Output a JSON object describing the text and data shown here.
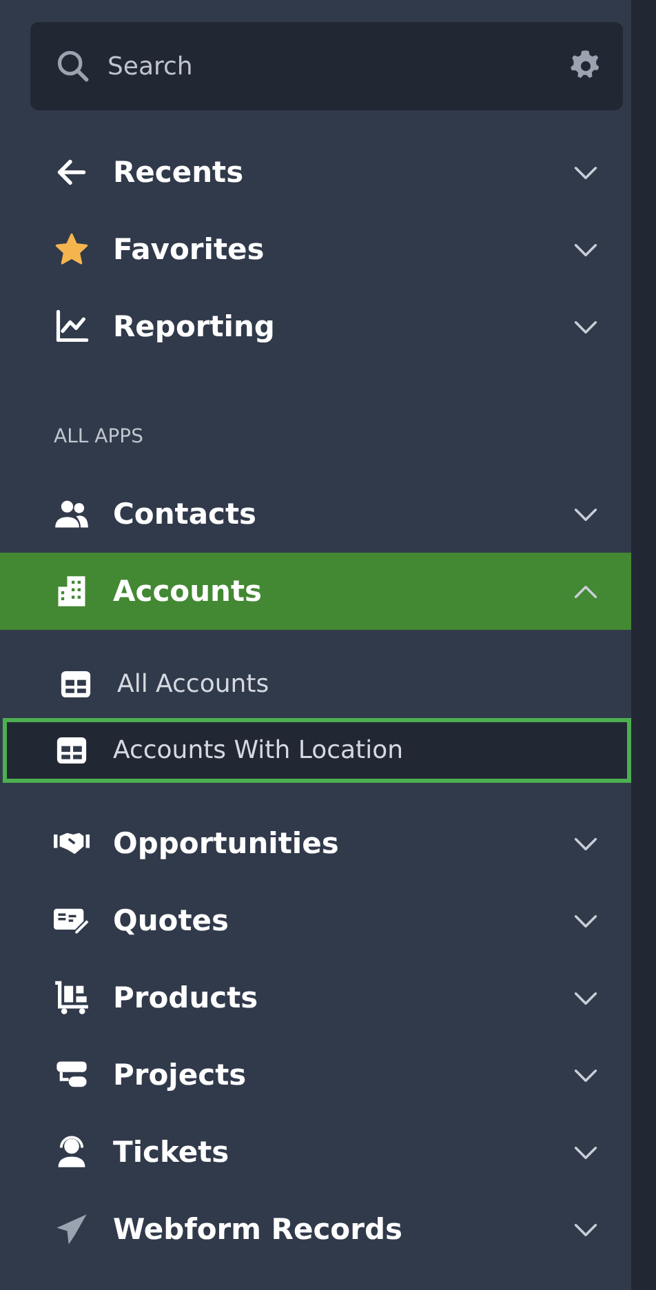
{
  "search": {
    "placeholder": "Search"
  },
  "quick_links": [
    {
      "label": "Recents",
      "expanded": false
    },
    {
      "label": "Favorites",
      "expanded": false
    },
    {
      "label": "Reporting",
      "expanded": false
    }
  ],
  "section_label": "ALL APPS",
  "apps": [
    {
      "label": "Contacts",
      "selected": false,
      "expanded": false
    },
    {
      "label": "Accounts",
      "selected": true,
      "expanded": true,
      "children": [
        {
          "label": "All Accounts",
          "selected": false
        },
        {
          "label": "Accounts With Location",
          "selected": true
        }
      ]
    },
    {
      "label": "Opportunities",
      "selected": false,
      "expanded": false
    },
    {
      "label": "Quotes",
      "selected": false,
      "expanded": false
    },
    {
      "label": "Products",
      "selected": false,
      "expanded": false
    },
    {
      "label": "Projects",
      "selected": false,
      "expanded": false
    },
    {
      "label": "Tickets",
      "selected": false,
      "expanded": false
    },
    {
      "label": "Webform Records",
      "selected": false,
      "expanded": false
    }
  ]
}
